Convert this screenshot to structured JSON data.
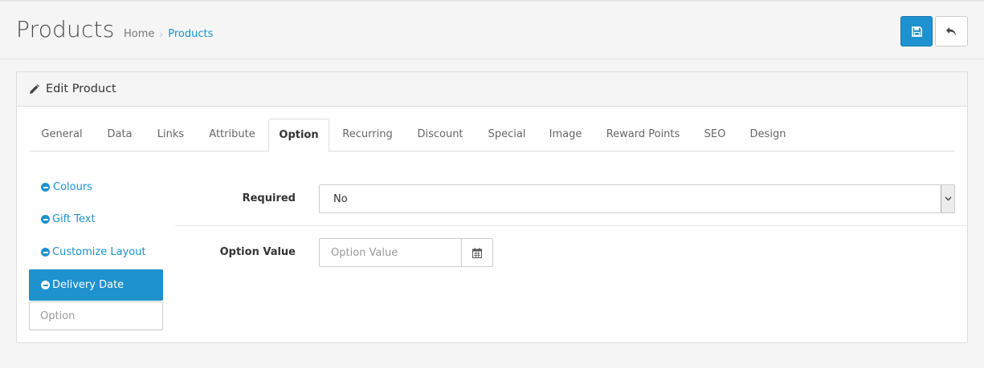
{
  "header": {
    "title": "Products",
    "breadcrumb": {
      "home": "Home",
      "separator": "›",
      "current": "Products"
    },
    "actions": {
      "save_icon": "save-icon",
      "back_icon": "reply-icon"
    }
  },
  "panel": {
    "title": "Edit Product",
    "title_icon": "pencil-icon"
  },
  "tabs": [
    {
      "label": "General"
    },
    {
      "label": "Data"
    },
    {
      "label": "Links"
    },
    {
      "label": "Attribute"
    },
    {
      "label": "Option"
    },
    {
      "label": "Recurring"
    },
    {
      "label": "Discount"
    },
    {
      "label": "Special"
    },
    {
      "label": "Image"
    },
    {
      "label": "Reward Points"
    },
    {
      "label": "SEO"
    },
    {
      "label": "Design"
    }
  ],
  "active_tab": "Option",
  "options_list": {
    "items": [
      {
        "label": "Colours",
        "icon": "minus-circle-icon"
      },
      {
        "label": "Gift Text",
        "icon": "minus-circle-icon"
      },
      {
        "label": "Customize Layout",
        "icon": "minus-circle-icon"
      },
      {
        "label": "Delivery Date",
        "icon": "minus-circle-icon"
      }
    ],
    "active": "Delivery Date",
    "add_placeholder": "Option"
  },
  "form": {
    "required_label": "Required",
    "required_value": "No",
    "option_value_label": "Option Value",
    "option_value_placeholder": "Option Value",
    "calendar_icon": "calendar-icon"
  },
  "colors": {
    "accent": "#1e91cf",
    "background": "#f5f5f5"
  }
}
